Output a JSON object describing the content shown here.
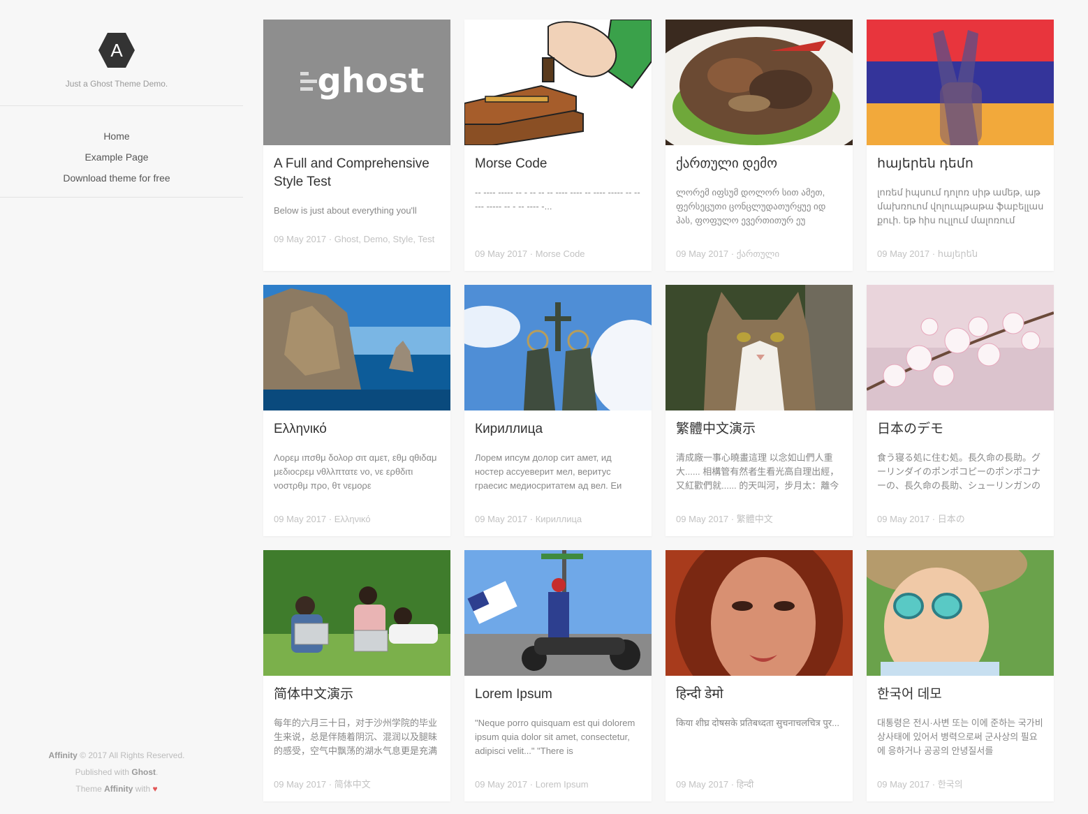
{
  "site": {
    "logo_letter": "A",
    "tagline": "Just a Ghost Theme Demo."
  },
  "nav": {
    "items": [
      {
        "label": "Home"
      },
      {
        "label": "Example Page"
      },
      {
        "label": "Download theme for free"
      }
    ]
  },
  "footer": {
    "brand": "Affinity",
    "copyright": "© 2017 All Rights Reserved.",
    "published_prefix": "Published with",
    "published_brand": "Ghost",
    "published_suffix": ".",
    "theme_prefix": "Theme",
    "theme_brand": "Affinity",
    "theme_suffix": "with",
    "heart": "♥"
  },
  "colors": {
    "background": "#f7f7f7",
    "card": "#ffffff",
    "title": "#333333",
    "excerpt": "#888888",
    "meta": "#c2c2c2",
    "heart": "#e25555"
  },
  "posts": [
    {
      "title": "A Full and Comprehensive Style Test",
      "excerpt": "Below is just about everything you'll",
      "meta": "09 May 2017 · Ghost, Demo, Style, Test",
      "image": "ghost-logo-image",
      "thumb_text": "ghost"
    },
    {
      "title": "Morse Code",
      "excerpt": "-- ---- ----- -- - -- -- -- ---- ---- -- ---- ----- -- ----- ----- -- - -- ---- -...",
      "meta": "09 May 2017 · Morse Code",
      "image": "telegraph-key-image"
    },
    {
      "title": "ქართული დემო",
      "excerpt": "ლორემ იფსუმ დოლორ სით ამეთ, ფერსეცუთი ცონცლუდათურყუე იდ ჰას, ფოფულო ევერთითურ ეუ",
      "meta": "09 May 2017 · ქართული",
      "image": "food-plate-image"
    },
    {
      "title": "հայերեն դեմո",
      "excerpt": "լոռեմ իպսում դոլոռ սիթ ամեթ, աթ մախռուոմ վոլուպթաթա ֆաբելլաս քուի. եթ հիս ուլլում մալոռում մելիոռե,",
      "meta": "09 May 2017 · հայերեն",
      "image": "armenian-flag-hand-image"
    },
    {
      "title": "Ελληνικό",
      "excerpt": "Λορεμ ιπσθμ δολορ σιτ αμετ, εθμ qθιδαμ μεδιοcρεμ νθλλπτατε νο, νε ερθδιτι νοστρθμ προ, θτ νεμορε",
      "meta": "09 May 2017 · Ελληνικό",
      "image": "greek-coast-image"
    },
    {
      "title": "Кириллица",
      "excerpt": "Лорем ипсум долор сит амет, ид ностер ассуеверит мел, веритус граеcис медиоcритатем ад вел. Еи",
      "meta": "09 May 2017 · Кириллица",
      "image": "monument-statue-image"
    },
    {
      "title": "繁體中文演示",
      "excerpt": "清成廠一事心曉畫這理 以念如山們人重大...... 相構管有然者生看光高自理出經，又紅歡們就...... 的天叫河，步月太：離今",
      "meta": "09 May 2017 · 繁體中文",
      "image": "cat-image"
    },
    {
      "title": "日本のデモ",
      "excerpt": "食う寝る処に住む処。長久命の長助。グーリンダイのポンポコピーのポンポコナーの、長久命の長助、シューリンガンの",
      "meta": "09 May 2017 · 日本の",
      "image": "cherry-blossom-image"
    },
    {
      "title": "简体中文演示",
      "excerpt": "每年的六月三十日，对于沙州学院的毕业生来说，总是伴随着阴沉、混润以及腿昧的感受，空气中飘荡的湖水气息更是充满",
      "meta": "09 May 2017 · 简体中文",
      "image": "students-laptops-image"
    },
    {
      "title": "Lorem Ipsum",
      "excerpt": "\"Neque porro quisquam est qui dolorem ipsum quia dolor sit amet, consectetur, adipisci velit...\" \"There is",
      "meta": "09 May 2017 · Lorem Ipsum",
      "image": "parade-motorcycle-image"
    },
    {
      "title": "हिन्दी डेमो",
      "excerpt": "किया शीघ्र दोषसके प्रतिबध्दता सुचनाचलचित्र पुर...",
      "meta": "09 May 2017 · हिन्दी",
      "image": "portrait-woman-image"
    },
    {
      "title": "한국어 데모",
      "excerpt": "대통령은 전시·사변 또는 이에 준하는 국가비상사태에 있어서 병력으로써 군사상의 필요에 응하거나 공공의 안녕질서를",
      "meta": "09 May 2017 · 한국의",
      "image": "child-sunglasses-image"
    }
  ]
}
